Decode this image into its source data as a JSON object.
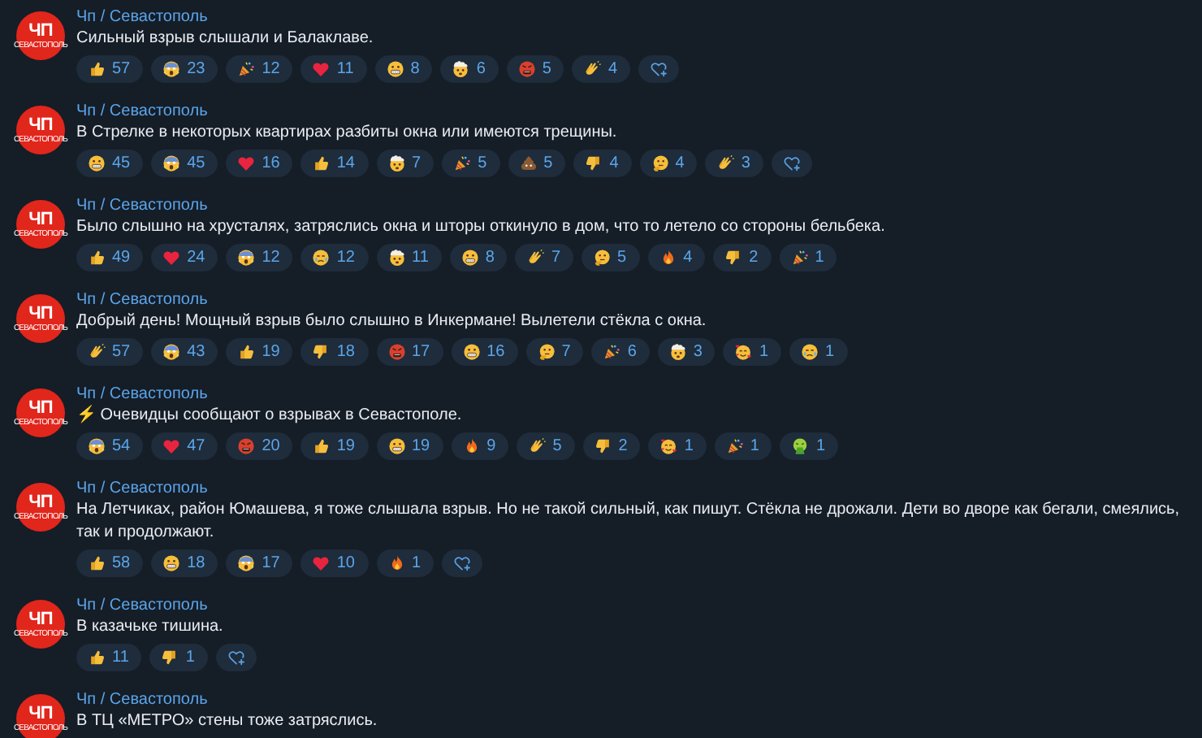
{
  "messages": [
    {
      "avatar": {
        "title": "ЧП",
        "subtitle": "СЕВАСТОПОЛЬ"
      },
      "author": "Чп / Севастополь",
      "text": "Сильный взрыв слышали и Балаклаве.",
      "add_reaction": true,
      "reactions": [
        {
          "kind": "thumbsup",
          "count": "57"
        },
        {
          "kind": "scream",
          "count": "23"
        },
        {
          "kind": "party",
          "count": "12"
        },
        {
          "kind": "heart",
          "count": "11"
        },
        {
          "kind": "grin",
          "count": "8"
        },
        {
          "kind": "exploding",
          "count": "6"
        },
        {
          "kind": "rage",
          "count": "5"
        },
        {
          "kind": "clap",
          "count": "4"
        }
      ]
    },
    {
      "avatar": {
        "title": "ЧП",
        "subtitle": "СЕВАСТОПОЛЬ"
      },
      "author": "Чп / Севастополь",
      "text": "В Стрелке в некоторых квартирах разбиты окна или имеются трещины.",
      "add_reaction": true,
      "reactions": [
        {
          "kind": "grin",
          "count": "45"
        },
        {
          "kind": "scream",
          "count": "45"
        },
        {
          "kind": "heart",
          "count": "16"
        },
        {
          "kind": "thumbsup",
          "count": "14"
        },
        {
          "kind": "exploding",
          "count": "7"
        },
        {
          "kind": "party",
          "count": "5"
        },
        {
          "kind": "poop",
          "count": "5"
        },
        {
          "kind": "thumbsdown",
          "count": "4"
        },
        {
          "kind": "thinking",
          "count": "4"
        },
        {
          "kind": "clap",
          "count": "3"
        }
      ]
    },
    {
      "avatar": {
        "title": "ЧП",
        "subtitle": "СЕВАСТОПОЛЬ"
      },
      "author": "Чп / Севастополь",
      "text": "Было слышно на хрусталях, затряслись окна и шторы откинуло в дом, что то летело со стороны бельбека.",
      "add_reaction": false,
      "reactions": [
        {
          "kind": "thumbsup",
          "count": "49"
        },
        {
          "kind": "heart",
          "count": "24"
        },
        {
          "kind": "scream",
          "count": "12"
        },
        {
          "kind": "cry",
          "count": "12"
        },
        {
          "kind": "exploding",
          "count": "11"
        },
        {
          "kind": "grin",
          "count": "8"
        },
        {
          "kind": "clap",
          "count": "7"
        },
        {
          "kind": "thinking",
          "count": "5"
        },
        {
          "kind": "fire",
          "count": "4"
        },
        {
          "kind": "thumbsdown",
          "count": "2"
        },
        {
          "kind": "party",
          "count": "1"
        }
      ]
    },
    {
      "avatar": {
        "title": "ЧП",
        "subtitle": "СЕВАСТОПОЛЬ"
      },
      "author": "Чп / Севастополь",
      "text": "Добрый день! Мощный взрыв было слышно в Инкермане! Вылетели стёкла с окна.",
      "add_reaction": false,
      "reactions": [
        {
          "kind": "clap",
          "count": "57"
        },
        {
          "kind": "scream",
          "count": "43"
        },
        {
          "kind": "thumbsup",
          "count": "19"
        },
        {
          "kind": "thumbsdown",
          "count": "18"
        },
        {
          "kind": "rage",
          "count": "17"
        },
        {
          "kind": "grin",
          "count": "16"
        },
        {
          "kind": "thinking",
          "count": "7"
        },
        {
          "kind": "party",
          "count": "6"
        },
        {
          "kind": "exploding",
          "count": "3"
        },
        {
          "kind": "loveface",
          "count": "1"
        },
        {
          "kind": "cry",
          "count": "1"
        }
      ]
    },
    {
      "avatar": {
        "title": "ЧП",
        "subtitle": "СЕВАСТОПОЛЬ"
      },
      "author": "Чп / Севастополь",
      "text": "⚡ Очевидцы сообщают о взрывах в Севастополе.",
      "add_reaction": false,
      "reactions": [
        {
          "kind": "scream",
          "count": "54"
        },
        {
          "kind": "heart",
          "count": "47"
        },
        {
          "kind": "rage",
          "count": "20"
        },
        {
          "kind": "thumbsup",
          "count": "19"
        },
        {
          "kind": "grin",
          "count": "19"
        },
        {
          "kind": "fire",
          "count": "9"
        },
        {
          "kind": "clap",
          "count": "5"
        },
        {
          "kind": "thumbsdown",
          "count": "2"
        },
        {
          "kind": "loveface",
          "count": "1"
        },
        {
          "kind": "party",
          "count": "1"
        },
        {
          "kind": "vomit",
          "count": "1"
        }
      ]
    },
    {
      "avatar": {
        "title": "ЧП",
        "subtitle": "СЕВАСТОПОЛЬ"
      },
      "author": "Чп / Севастополь",
      "text": "На Летчиках, район Юмашева, я тоже слышала взрыв. Но не такой сильный, как пишут. Стёкла не дрожали. Дети во дворе как бегали, смеялись, так и продолжают.",
      "add_reaction": true,
      "reactions": [
        {
          "kind": "thumbsup",
          "count": "58"
        },
        {
          "kind": "grin",
          "count": "18"
        },
        {
          "kind": "scream",
          "count": "17"
        },
        {
          "kind": "heart",
          "count": "10"
        },
        {
          "kind": "fire",
          "count": "1"
        }
      ]
    },
    {
      "avatar": {
        "title": "ЧП",
        "subtitle": "СЕВАСТОПОЛЬ"
      },
      "author": "Чп / Севастополь",
      "text": "В казачьке тишина.",
      "add_reaction": true,
      "reactions": [
        {
          "kind": "thumbsup",
          "count": "11"
        },
        {
          "kind": "thumbsdown",
          "count": "1"
        }
      ]
    },
    {
      "avatar": {
        "title": "ЧП",
        "subtitle": "СЕВАСТОПОЛЬ"
      },
      "author": "Чп / Севастополь",
      "text": "В ТЦ «МЕТРО» стены тоже затряслись."
    }
  ]
}
